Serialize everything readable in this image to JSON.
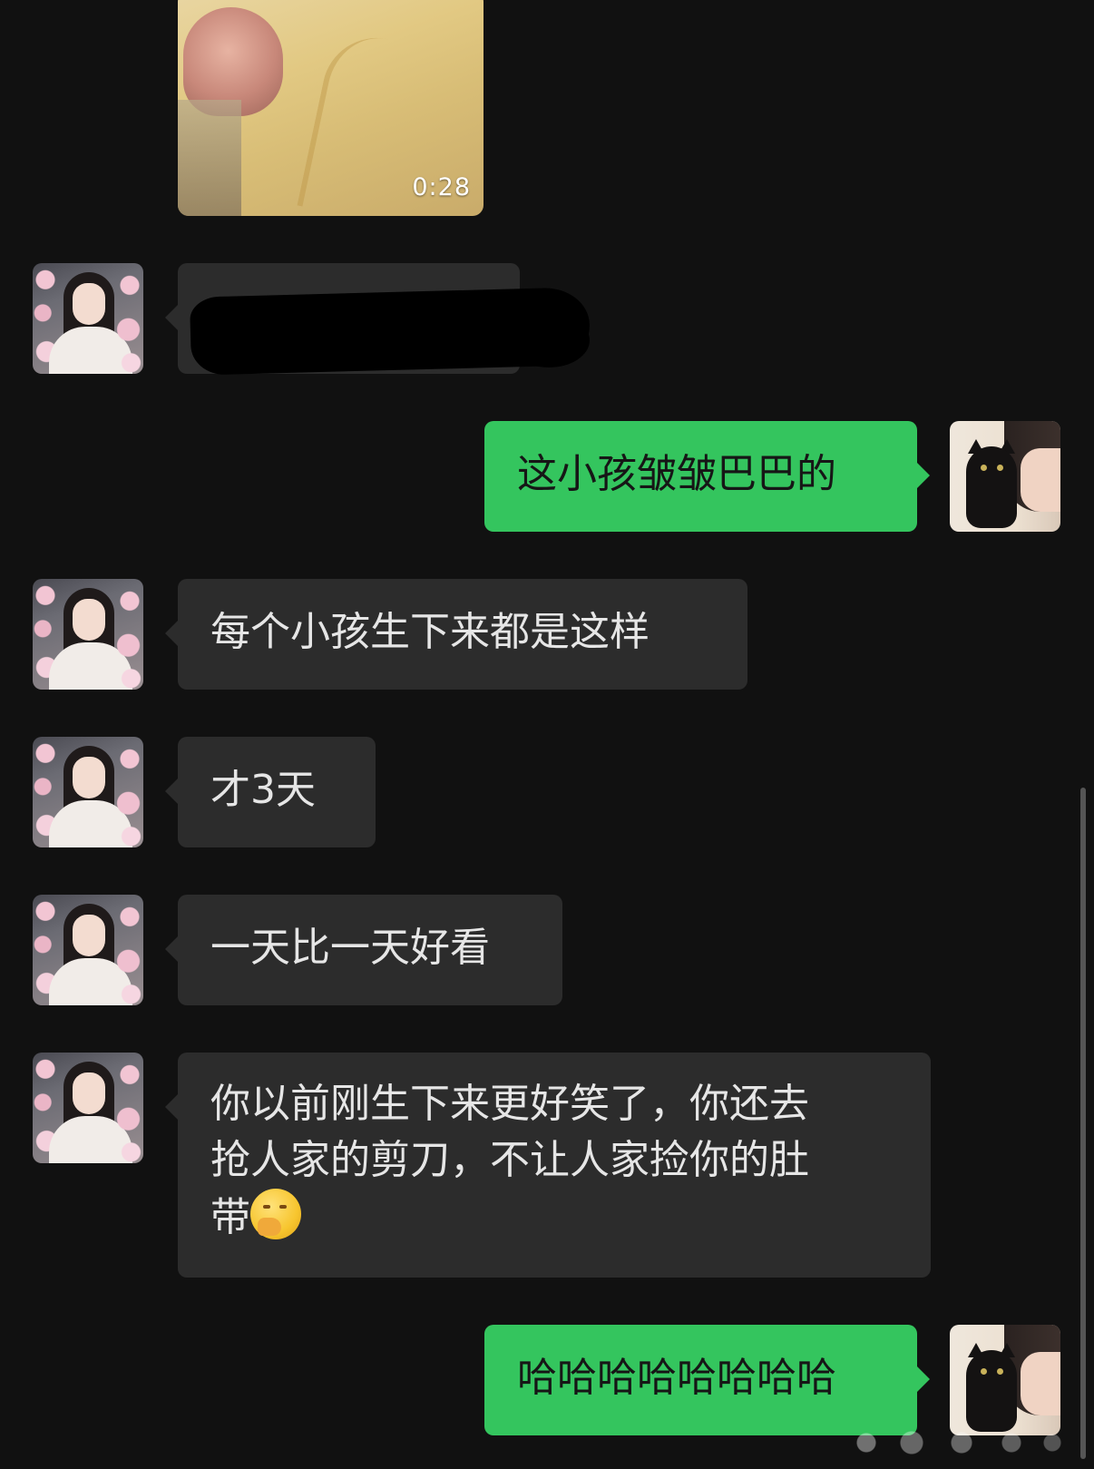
{
  "video": {
    "duration": "0:28"
  },
  "messages": [
    {
      "side": "in",
      "text": ""
    },
    {
      "side": "out",
      "text": "这小孩皱皱巴巴的"
    },
    {
      "side": "in",
      "text": "每个小孩生下来都是这样"
    },
    {
      "side": "in",
      "text": "才3天"
    },
    {
      "side": "in",
      "text": "一天比一天好看"
    },
    {
      "side": "in",
      "text_lines": [
        "你以前刚生下来更好笑了，你还去",
        "抢人家的剪刀，不让人家捡你的肚",
        "带"
      ],
      "emoji": "thinking-face-icon"
    },
    {
      "side": "out",
      "text": "哈哈哈哈哈哈哈哈"
    }
  ],
  "colors": {
    "background": "#111111",
    "incoming_bubble": "#2c2c2c",
    "outgoing_bubble": "#34c55e",
    "incoming_text": "#e6e6e6",
    "outgoing_text": "#161616"
  }
}
